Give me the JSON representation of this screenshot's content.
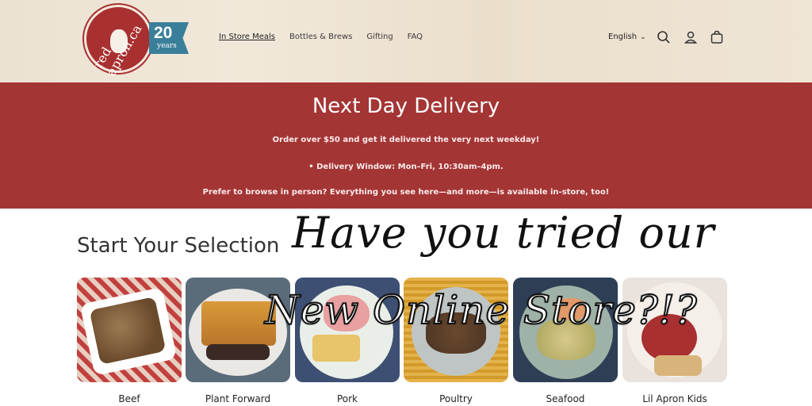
{
  "header": {
    "logo_text": "red apron.ca",
    "badge_number": "20",
    "badge_word": "years",
    "nav": [
      {
        "label": "In Store Meals",
        "active": true
      },
      {
        "label": "Bottles & Brews"
      },
      {
        "label": "Gifting"
      },
      {
        "label": "FAQ"
      }
    ],
    "language": "English",
    "icons": [
      "search-icon",
      "account-icon",
      "cart-icon"
    ]
  },
  "banner": {
    "title": "Next Day Delivery",
    "line1": "Order over $50 and get it delivered the very next weekday!",
    "line2": "•  Delivery Window: Mon–Fri, 10:30am–4pm.",
    "line3": "Prefer to browse in person? Everything you see here—and more—is available in-store, too!",
    "color": "#a43535"
  },
  "main": {
    "section_title": "Start Your Selection",
    "promo_line1": "Have you tried our",
    "promo_line2": "New Online Store?!?",
    "categories": [
      {
        "label": "Beef"
      },
      {
        "label": "Plant Forward"
      },
      {
        "label": "Pork"
      },
      {
        "label": "Poultry"
      },
      {
        "label": "Seafood"
      },
      {
        "label": "Lil Apron Kids"
      }
    ]
  }
}
